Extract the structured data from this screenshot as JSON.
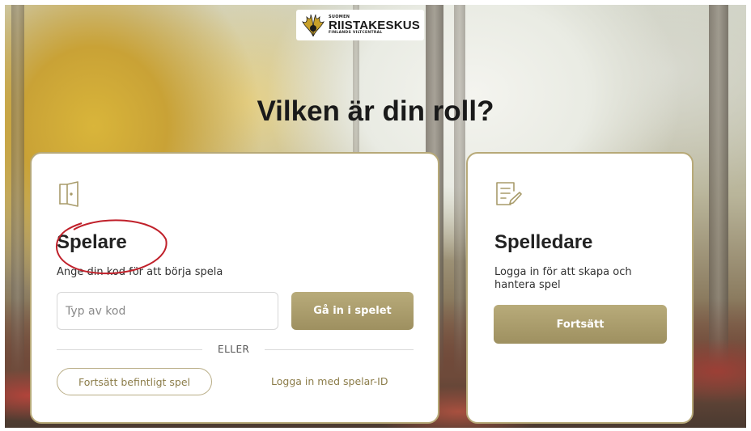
{
  "brand": {
    "small_top": "SUOMEN",
    "name": "RIISTAKESKUS",
    "sub": "FINLANDS VILTCENTRAL"
  },
  "page": {
    "title": "Vilken är din roll?"
  },
  "player": {
    "icon": "door-icon",
    "heading": "Spelare",
    "description": "Ange din kod för att börja spela",
    "code_placeholder": "Typ av kod",
    "join_button": "Gå in i spelet",
    "or_label": "ELLER",
    "continue_existing": "Fortsätt befintligt spel",
    "login_link": "Logga in med spelar-ID"
  },
  "leader": {
    "icon": "edit-document-icon",
    "heading": "Spelledare",
    "description": "Logga in för att skapa och hantera spel",
    "continue_button": "Fortsätt"
  },
  "colors": {
    "accent": "#a89b6a",
    "card_border": "#b7a978",
    "annotation_red": "#c0202a"
  }
}
